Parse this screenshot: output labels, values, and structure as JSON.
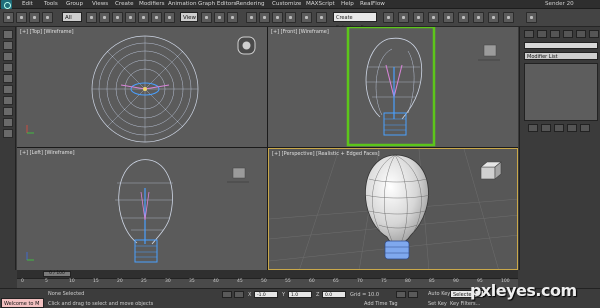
{
  "menubar": {
    "items": [
      "Edit",
      "Tools",
      "Group",
      "Views",
      "Create",
      "Modifiers",
      "Animation",
      "Graph Editors",
      "Rendering",
      "Customize",
      "MAXScript",
      "Help",
      "RealFlow"
    ],
    "title_right": "Sender 20"
  },
  "toolbar": {
    "filter_value": "All",
    "view_value": "View",
    "search_value": "Create Selection Se"
  },
  "viewports": {
    "top_label": "[+] [Top] [Wireframe]",
    "front_label": "[+] [Front] [Wireframe]",
    "left_label": "[+] [Left] [Wireframe]",
    "perspective_label": "[+] [Perspective] [Realistic + Edged Faces]",
    "highlight_color": "#5cc61a"
  },
  "command_panel": {
    "modifier_list": "Modifier List"
  },
  "timeline": {
    "slider_text": "0 / 100",
    "ticks": [
      "0",
      "5",
      "10",
      "15",
      "20",
      "25",
      "30",
      "35",
      "40",
      "45",
      "50",
      "55",
      "60",
      "65",
      "70",
      "75",
      "80",
      "85",
      "90",
      "95",
      "100"
    ]
  },
  "status": {
    "listener_text": "Welcome to M",
    "selection_text": "None Selected",
    "prompt_text": "Click and drag to select and move objects",
    "x_value": "-1.0",
    "y_value": "1.0",
    "z_value": "0.0",
    "grid_text": "Grid = 10.0",
    "add_time_tag": "Add Time Tag",
    "auto_key": "Auto Key",
    "set_key": "Set Key",
    "selected_value": "Selected",
    "key_filters": "Key Filters..."
  },
  "watermark": "pxleyes.com"
}
